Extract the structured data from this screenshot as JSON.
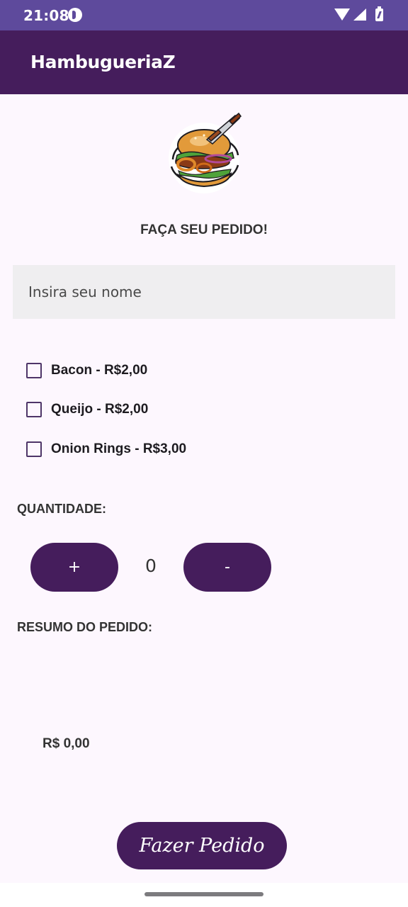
{
  "status_bar": {
    "time": "21:08"
  },
  "app_bar": {
    "title": "HambugueriaZ"
  },
  "order_form": {
    "heading": "FAÇA SEU PEDIDO!",
    "name_placeholder": "Insira seu nome",
    "toppings": [
      {
        "label": "Bacon - R$2,00",
        "checked": false
      },
      {
        "label": "Queijo - R$2,00",
        "checked": false
      },
      {
        "label": "Onion Rings - R$3,00",
        "checked": false
      }
    ],
    "quantity_label": "QUANTIDADE:",
    "increase_label": "+",
    "decrease_label": "-",
    "quantity_value": "0",
    "summary_label": "RESUMO DO PEDIDO:",
    "total": "R$ 0,00",
    "submit_label": "Fazer Pedido"
  },
  "colors": {
    "status_bar": "#5E4A9C",
    "app_bar": "#451D5C",
    "button": "#451D5C",
    "background": "#FDF7FE",
    "input_background": "#EFEEF0"
  },
  "icons": [
    "app-notification-icon",
    "wifi-icon",
    "signal-icon",
    "battery-icon",
    "burger-logo-icon"
  ]
}
